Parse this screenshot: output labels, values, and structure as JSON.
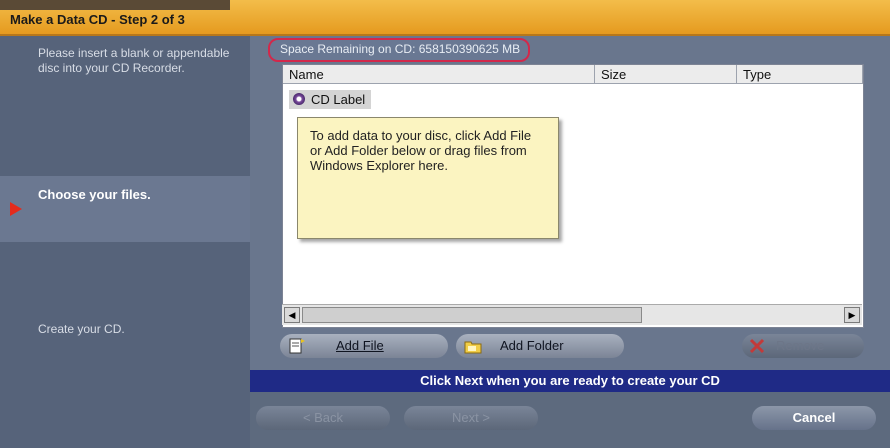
{
  "window": {
    "title": "Make a Data CD - Step 2 of 3"
  },
  "steps": [
    {
      "label": "Please insert a blank or appendable disc into your CD Recorder."
    },
    {
      "label": "Choose your files."
    },
    {
      "label": "Create your CD."
    }
  ],
  "space": {
    "text": "Space Remaining on CD: 658150390625 MB"
  },
  "list": {
    "columns": [
      "Name",
      "Size",
      "Type"
    ],
    "item": "CD Label",
    "tip": "To add data to your disc, click Add File or Add Folder below or drag files from Windows Explorer here."
  },
  "buttons": {
    "add_file": "Add File",
    "add_folder": "Add Folder",
    "remove": "Remove",
    "back": "< Back",
    "next": "Next >",
    "cancel": "Cancel"
  },
  "banner": "Click Next when you are ready to create your CD",
  "icons": [
    "add-file-icon",
    "add-folder-icon",
    "remove-x-icon",
    "cd-icon",
    "arrow-left-icon",
    "arrow-right-icon"
  ],
  "colors": {
    "title_bar": "#e59a1f",
    "banner": "#1f2a86",
    "highlight": "#d2284b",
    "current_step_arrow": "#e42b1c"
  }
}
